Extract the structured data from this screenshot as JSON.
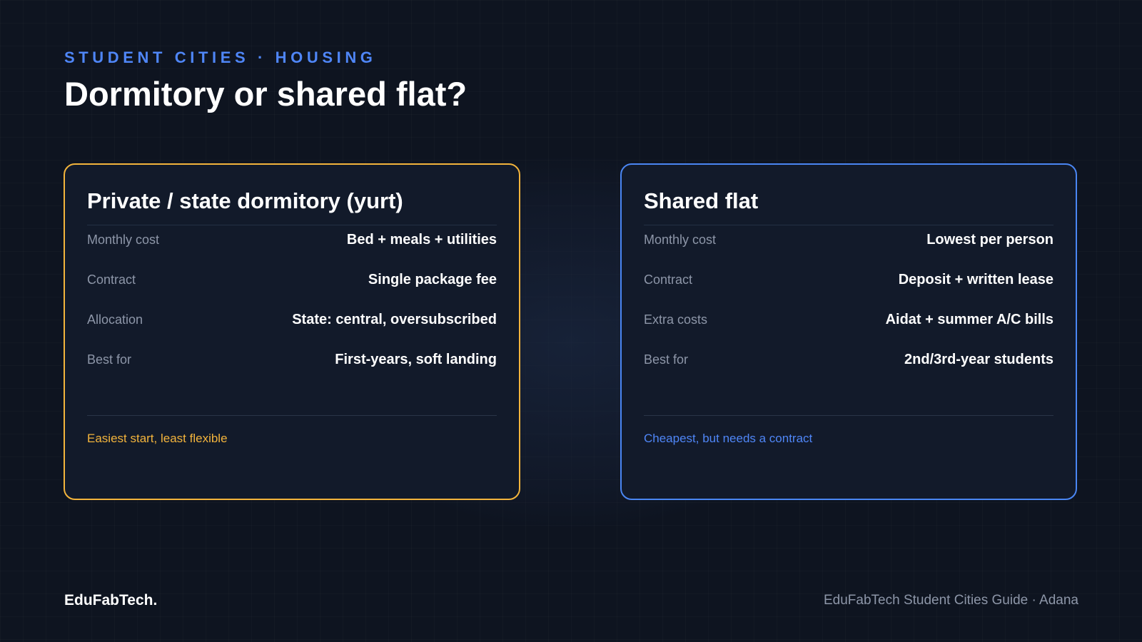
{
  "header": {
    "eyebrow": "STUDENT CITIES · HOUSING",
    "title": "Dormitory or shared flat?"
  },
  "cards": [
    {
      "title": "Private / state dormitory (yurt)",
      "accent_color": "#f3b43c",
      "rows": [
        {
          "label": "Monthly cost",
          "value": "Bed + meals + utilities"
        },
        {
          "label": "Contract",
          "value": "Single package fee"
        },
        {
          "label": "Allocation",
          "value": "State: central, oversubscribed"
        },
        {
          "label": "Best for",
          "value": "First-years, soft landing"
        }
      ],
      "note": "Easiest start, least flexible"
    },
    {
      "title": "Shared flat",
      "accent_color": "#4a86f3",
      "rows": [
        {
          "label": "Monthly cost",
          "value": "Lowest per person"
        },
        {
          "label": "Contract",
          "value": "Deposit + written lease"
        },
        {
          "label": "Extra costs",
          "value": "Aidat + summer A/C bills"
        },
        {
          "label": "Best for",
          "value": "2nd/3rd-year students"
        }
      ],
      "note": "Cheapest, but needs a contract"
    }
  ],
  "footer": {
    "brand": "EduFabTech.",
    "text": "EduFabTech Student Cities Guide · Adana"
  }
}
